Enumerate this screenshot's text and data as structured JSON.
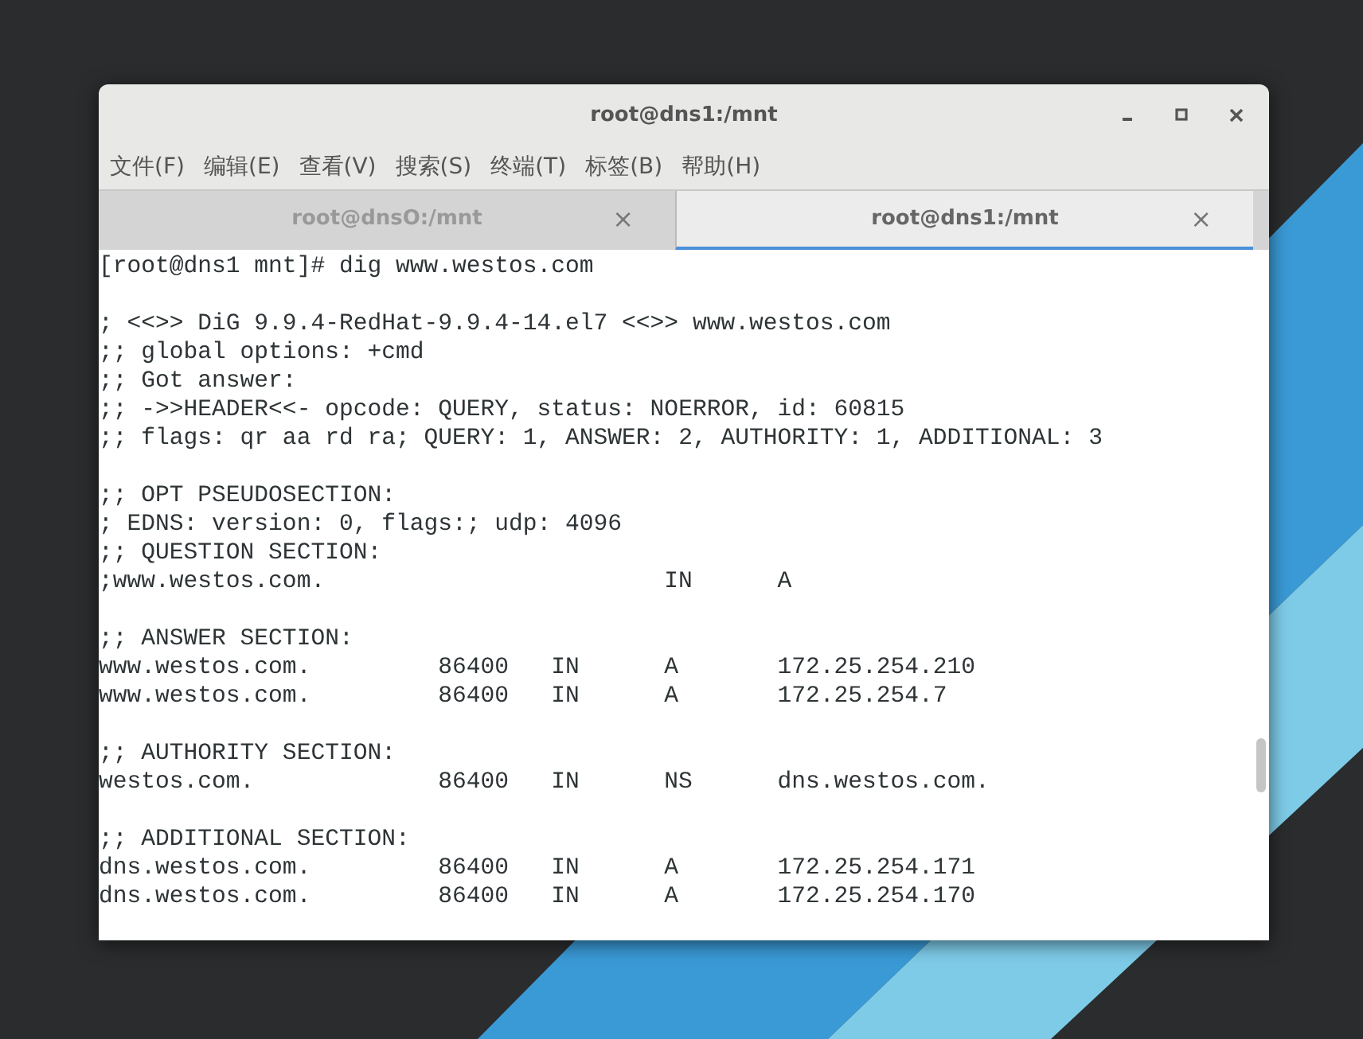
{
  "window": {
    "title": "root@dns1:/mnt"
  },
  "menu": [
    "文件(F)",
    "编辑(E)",
    "查看(V)",
    "搜索(S)",
    "终端(T)",
    "标签(B)",
    "帮助(H)"
  ],
  "tabs": [
    {
      "label": "root@dnsO:/mnt",
      "close": "×",
      "selected": false
    },
    {
      "label": "root@dns1:/mnt",
      "close": "×",
      "selected": true
    }
  ],
  "terminal": {
    "lines": [
      {
        "kind": "text",
        "text": "[root@dns1 mnt]# dig www.westos.com"
      },
      {
        "kind": "blank"
      },
      {
        "kind": "text",
        "text": "; <<>> DiG 9.9.4-RedHat-9.9.4-14.el7 <<>> www.westos.com"
      },
      {
        "kind": "text",
        "text": ";; global options: +cmd"
      },
      {
        "kind": "text",
        "text": ";; Got answer:"
      },
      {
        "kind": "text",
        "text": ";; ->>HEADER<<- opcode: QUERY, status: NOERROR, id: 60815"
      },
      {
        "kind": "text",
        "text": ";; flags: qr aa rd ra; QUERY: 1, ANSWER: 2, AUTHORITY: 1, ADDITIONAL: 3"
      },
      {
        "kind": "blank"
      },
      {
        "kind": "text",
        "text": ";; OPT PSEUDOSECTION:"
      },
      {
        "kind": "text",
        "text": "; EDNS: version: 0, flags:; udp: 4096"
      },
      {
        "kind": "text",
        "text": ";; QUESTION SECTION:"
      },
      {
        "kind": "question",
        "fields": [
          ";www.westos.com.",
          "IN",
          "A"
        ]
      },
      {
        "kind": "blank"
      },
      {
        "kind": "text",
        "text": ";; ANSWER SECTION:"
      },
      {
        "kind": "record",
        "fields": [
          "www.westos.com.",
          "86400",
          "IN",
          "A",
          "172.25.254.210"
        ]
      },
      {
        "kind": "record",
        "fields": [
          "www.westos.com.",
          "86400",
          "IN",
          "A",
          "172.25.254.7"
        ]
      },
      {
        "kind": "blank"
      },
      {
        "kind": "text",
        "text": ";; AUTHORITY SECTION:"
      },
      {
        "kind": "record",
        "fields": [
          "westos.com.",
          "86400",
          "IN",
          "NS",
          "dns.westos.com."
        ]
      },
      {
        "kind": "blank"
      },
      {
        "kind": "text",
        "text": ";; ADDITIONAL SECTION:"
      },
      {
        "kind": "record",
        "fields": [
          "dns.westos.com.",
          "86400",
          "IN",
          "A",
          "172.25.254.171"
        ]
      },
      {
        "kind": "record",
        "fields": [
          "dns.westos.com.",
          "86400",
          "IN",
          "A",
          "172.25.254.170"
        ]
      }
    ]
  }
}
